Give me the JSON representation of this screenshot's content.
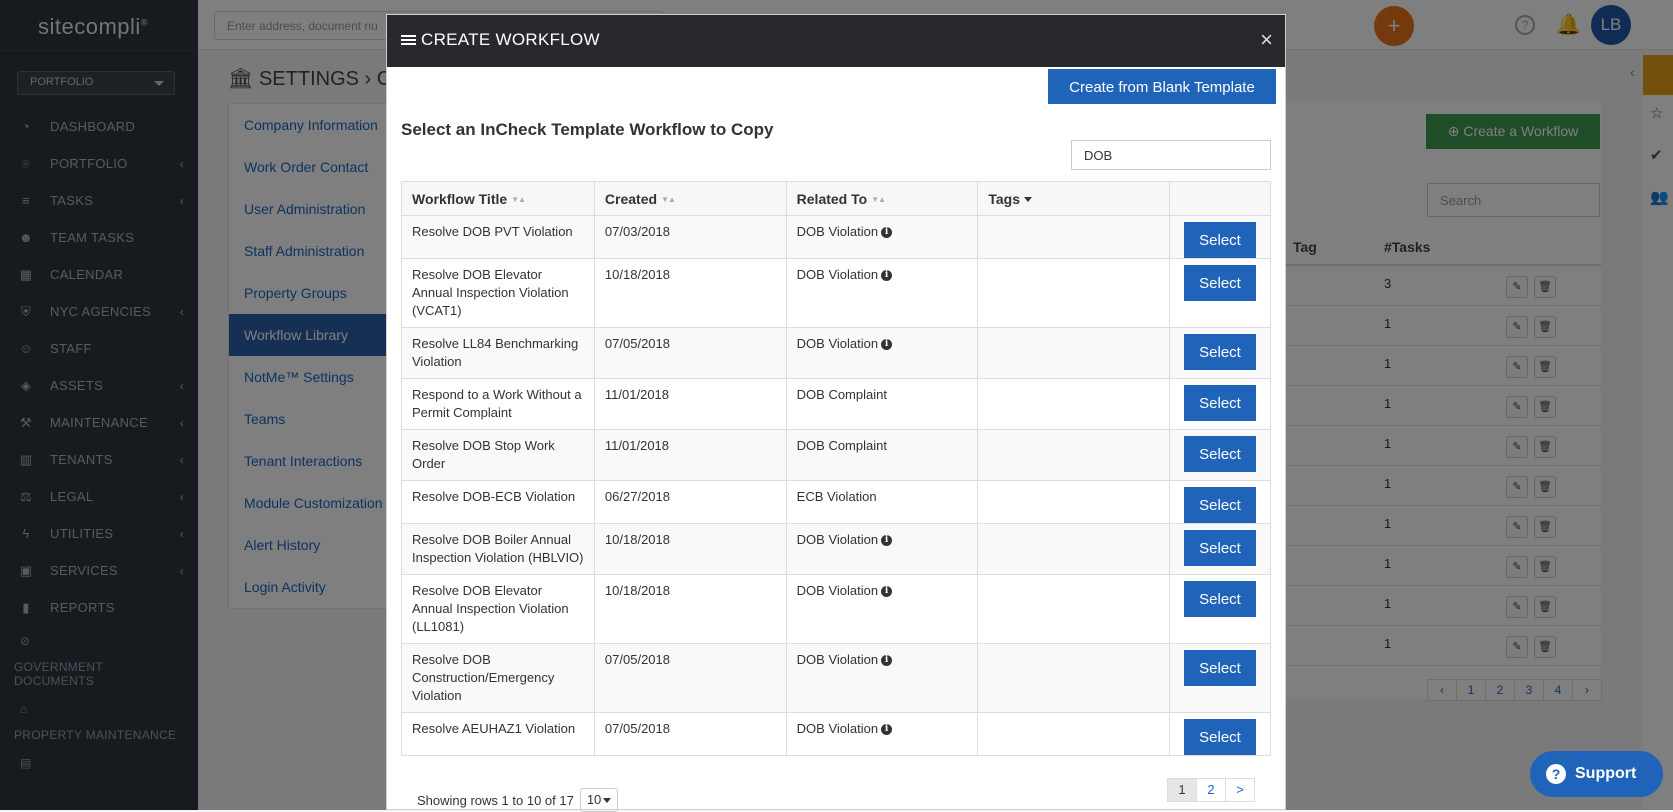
{
  "app": {
    "logo": "sitecompli",
    "search_placeholder": "Enter address, document nu",
    "avatar_initials": "LB",
    "plus_label": "+"
  },
  "sidebar": {
    "portfolio_label": "PORTFOLIO",
    "items": [
      {
        "label": "DASHBOARD",
        "icon": "dashboard-icon"
      },
      {
        "label": "PORTFOLIO",
        "icon": "map-pin-icon",
        "chevron": "‹"
      },
      {
        "label": "TASKS",
        "icon": "list-icon",
        "chevron": "‹"
      },
      {
        "label": "TEAM TASKS",
        "icon": "team-icon"
      },
      {
        "label": "CALENDAR",
        "icon": "calendar-icon"
      },
      {
        "label": "NYC AGENCIES",
        "icon": "shield-icon",
        "chevron": "‹"
      },
      {
        "label": "STAFF",
        "icon": "user-icon"
      },
      {
        "label": "ASSETS",
        "icon": "cube-icon",
        "chevron": "‹"
      },
      {
        "label": "MAINTENANCE",
        "icon": "wrench-icon",
        "chevron": "‹"
      },
      {
        "label": "TENANTS",
        "icon": "building-icon",
        "chevron": "‹"
      },
      {
        "label": "LEGAL",
        "icon": "gavel-icon",
        "chevron": "‹"
      },
      {
        "label": "UTILITIES",
        "icon": "bolt-icon",
        "chevron": "‹"
      },
      {
        "label": "SERVICES",
        "icon": "briefcase-icon",
        "chevron": "‹"
      },
      {
        "label": "REPORTS",
        "icon": "bar-chart-icon"
      }
    ],
    "section_gov": "GOVERNMENT DOCUMENTS",
    "section_pm": "PROPERTY MAINTENANCE"
  },
  "page": {
    "title": "SETTINGS › CO",
    "settings_menu": [
      {
        "label": "Company Information",
        "active": false
      },
      {
        "label": "Work Order Contact",
        "active": false
      },
      {
        "label": "User Administration",
        "active": false
      },
      {
        "label": "Staff Administration",
        "active": false
      },
      {
        "label": "Property Groups",
        "active": false
      },
      {
        "label": "Workflow Library",
        "active": true
      },
      {
        "label": "NotMe™ Settings",
        "active": false
      },
      {
        "label": "Teams",
        "active": false
      },
      {
        "label": "Tenant Interactions",
        "active": false
      },
      {
        "label": "Module Customization",
        "active": false
      },
      {
        "label": "Alert History",
        "active": false
      },
      {
        "label": "Login Activity",
        "active": false
      }
    ],
    "create_workflow_label": "Create a Workflow",
    "search_placeholder": "Search",
    "col_tag": "Tag",
    "col_tasks": "#Tasks",
    "task_counts": [
      "3",
      "1",
      "1",
      "1",
      "1",
      "1",
      "1",
      "1",
      "1",
      "1"
    ],
    "pager": [
      "‹",
      "1",
      "2",
      "3",
      "4",
      "›"
    ]
  },
  "support": {
    "label": "Support",
    "icon": "?"
  },
  "modal": {
    "title": "CREATE WORKFLOW",
    "close_label": "×",
    "blank_template_label": "Create from Blank Template",
    "subtitle": "Select an InCheck Template Workflow to Copy",
    "filter_value": "DOB",
    "columns": [
      "Workflow Title",
      "Created",
      "Related To",
      "Tags"
    ],
    "select_label": "Select",
    "rows": [
      {
        "title": "Resolve DOB PVT Violation",
        "created": "07/03/2018",
        "related": "DOB Violation",
        "info": true
      },
      {
        "title": "Resolve DOB Elevator Annual Inspection Violation (VCAT1)",
        "created": "10/18/2018",
        "related": "DOB Violation",
        "info": true
      },
      {
        "title": "Resolve LL84 Benchmarking Violation",
        "created": "07/05/2018",
        "related": "DOB Violation",
        "info": true
      },
      {
        "title": "Respond to a Work Without a Permit Complaint",
        "created": "11/01/2018",
        "related": "DOB Complaint",
        "info": false
      },
      {
        "title": "Resolve DOB Stop Work Order",
        "created": "11/01/2018",
        "related": "DOB Complaint",
        "info": false
      },
      {
        "title": "Resolve DOB-ECB Violation",
        "created": "06/27/2018",
        "related": "ECB Violation",
        "info": false
      },
      {
        "title": "Resolve DOB Boiler Annual Inspection Violation (HBLVIO)",
        "created": "10/18/2018",
        "related": "DOB Violation",
        "info": true
      },
      {
        "title": "Resolve DOB Elevator Annual Inspection Violation (LL1081)",
        "created": "10/18/2018",
        "related": "DOB Violation",
        "info": true
      },
      {
        "title": "Resolve DOB Construction/Emergency Violation",
        "created": "07/05/2018",
        "related": "DOB Violation",
        "info": true
      },
      {
        "title": "Resolve AEUHAZ1 Violation",
        "created": "07/05/2018",
        "related": "DOB Violation",
        "info": true
      }
    ],
    "footer_text": "Showing rows 1 to 10 of 17",
    "page_size": "10",
    "pages": [
      "1",
      "2",
      ">"
    ]
  }
}
